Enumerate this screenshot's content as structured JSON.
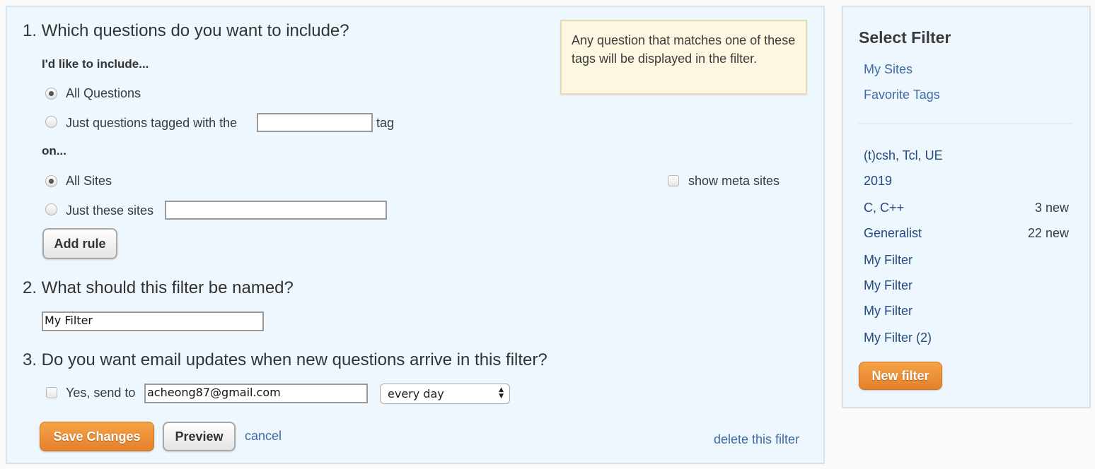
{
  "main": {
    "q1": {
      "heading": "1. Which questions do you want to include?",
      "include_label": "I'd like to include...",
      "option_all": "All Questions",
      "option_tagged": "Just questions tagged with the",
      "tag_input_value": "",
      "tag_suffix": "tag",
      "on_label": "on...",
      "option_all_sites": "All Sites",
      "option_these_sites": "Just these sites",
      "sites_input_value": "",
      "show_meta_sites": "show meta sites",
      "add_rule": "Add rule",
      "hint": "Any question that matches one of these tags will be displayed in the filter."
    },
    "q2": {
      "heading": "2. What should this filter be named?",
      "name_value": "My Filter"
    },
    "q3": {
      "heading": "3. Do you want email updates when new questions arrive in this filter?",
      "yes_send_to": "Yes, send to",
      "email_value": "acheong87@gmail.com",
      "frequency_selected": "every day"
    },
    "actions": {
      "save": "Save Changes",
      "preview": "Preview",
      "cancel": "cancel",
      "delete": "delete this filter"
    }
  },
  "sidebar": {
    "title": "Select Filter",
    "links": [
      "My Sites",
      "Favorite Tags"
    ],
    "filters": [
      {
        "name": "(t)csh, Tcl, UE",
        "count": ""
      },
      {
        "name": "2019",
        "count": ""
      },
      {
        "name": "C, C++",
        "count": "3 new"
      },
      {
        "name": "Generalist",
        "count": "22 new"
      },
      {
        "name": "My Filter",
        "count": ""
      },
      {
        "name": "My Filter",
        "count": ""
      },
      {
        "name": "My Filter",
        "count": ""
      },
      {
        "name": "My Filter (2)",
        "count": ""
      }
    ],
    "new_filter": "New filter"
  },
  "colors": {
    "panel_bg": "#edf7fd",
    "hint_bg": "#fdf7e1",
    "link": "#3f6aa6",
    "filter_link": "#244a7e",
    "orange_button": "#e5802b"
  }
}
